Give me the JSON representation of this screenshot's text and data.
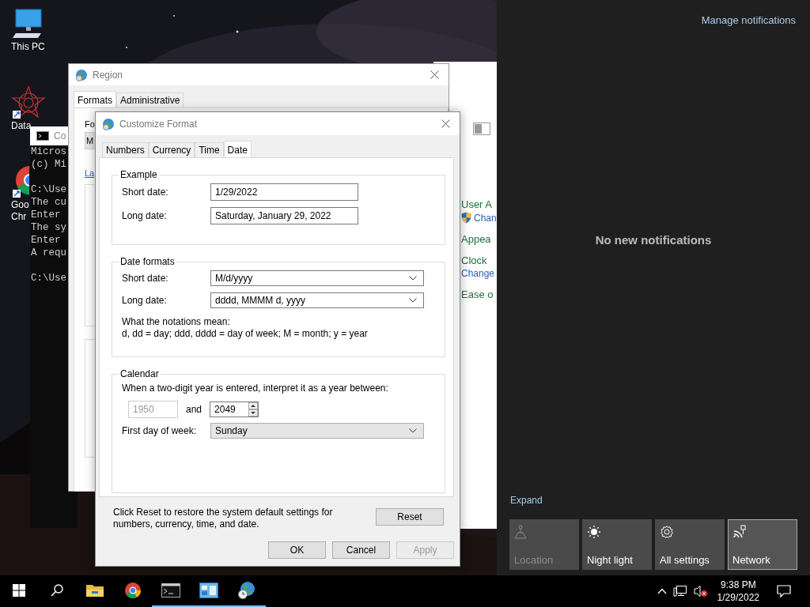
{
  "desktop": {
    "icons": [
      {
        "kind": "computer",
        "lines": [
          "This PC"
        ]
      },
      {
        "kind": "star",
        "lines": [
          "Data"
        ]
      },
      {
        "kind": "browser",
        "lines": [
          "Goo",
          "Chr"
        ]
      }
    ]
  },
  "console": {
    "title": "Co",
    "blocks": [
      [
        "Micros",
        "(c) Mi"
      ],
      [
        "C:\\Use",
        "The cu",
        "Enter",
        "The sy",
        "Enter",
        "A requ"
      ],
      [
        "C:\\Use"
      ]
    ]
  },
  "region_window": {
    "title": "Region",
    "tabs": [
      {
        "label": "Formats",
        "selected": true
      },
      {
        "label": "Administrative",
        "selected": false
      }
    ],
    "format_label": "Fo",
    "format_value": "M",
    "link": "La"
  },
  "control_panel": {
    "sections": [
      {
        "heading": "User A",
        "link": "Chan",
        "shield": true
      },
      {
        "heading": "Appea"
      },
      {
        "heading": "Clock",
        "link": "Change"
      },
      {
        "heading": "Ease o"
      }
    ]
  },
  "customize_format": {
    "title": "Customize Format",
    "tabs": [
      {
        "label": "Numbers",
        "selected": false
      },
      {
        "label": "Currency",
        "selected": false
      },
      {
        "label": "Time",
        "selected": false
      },
      {
        "label": "Date",
        "selected": true
      }
    ],
    "example": {
      "title": "Example",
      "rows": [
        {
          "label": "Short date:",
          "value": "1/29/2022"
        },
        {
          "label": "Long date:",
          "value": "Saturday, January 29, 2022"
        }
      ]
    },
    "date_formats": {
      "title": "Date formats",
      "rows": [
        {
          "label": "Short date:",
          "value": "M/d/yyyy"
        },
        {
          "label": "Long date:",
          "value": "dddd, MMMM d, yyyy"
        }
      ],
      "notes_title": "What the notations mean:",
      "notes": "d, dd = day;  ddd, dddd = day of week;  M = month;  y = year"
    },
    "calendar": {
      "title": "Calendar",
      "prompt": "When a two-digit year is entered, interpret it as a year between:",
      "from_year": "1950",
      "from_disabled": true,
      "and": "and",
      "to_year": "2049",
      "first_day_label": "First day of week:",
      "first_day": "Sunday"
    },
    "reset_note": "Click Reset to restore the system default settings for numbers, currency, time, and date.",
    "reset": "Reset",
    "buttons": [
      {
        "label": "OK",
        "disabled": false
      },
      {
        "label": "Cancel",
        "disabled": false
      },
      {
        "label": "Apply",
        "disabled": true
      }
    ]
  },
  "action_center": {
    "manage": "Manage notifications",
    "empty": "No new notifications",
    "expand": "Expand",
    "tiles": [
      {
        "kind": "location",
        "label": "Location",
        "disabled": true,
        "selected": false
      },
      {
        "kind": "night_light",
        "label": "Night light",
        "disabled": false,
        "selected": false
      },
      {
        "kind": "settings",
        "label": "All settings",
        "disabled": false,
        "selected": false
      },
      {
        "kind": "network",
        "label": "Network",
        "disabled": false,
        "selected": true
      }
    ]
  },
  "taskbar": {
    "buttons": [
      {
        "kind": "start",
        "running": false
      },
      {
        "kind": "search",
        "running": false
      },
      {
        "kind": "explorer",
        "running": false
      },
      {
        "kind": "browser",
        "running": false
      },
      {
        "kind": "console",
        "running": true
      },
      {
        "kind": "control_panel",
        "running": true
      },
      {
        "kind": "region",
        "running": true
      }
    ],
    "tray": [
      {
        "kind": "chevron"
      },
      {
        "kind": "network"
      },
      {
        "kind": "volume_muted"
      }
    ],
    "time": "9:38 PM",
    "date": "1/29/2022"
  }
}
